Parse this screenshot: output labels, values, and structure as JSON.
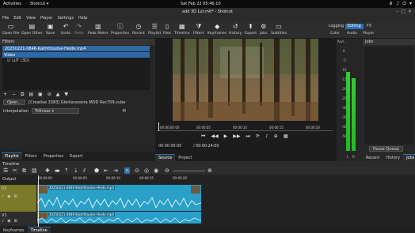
{
  "topbar": {
    "activities": "Activities",
    "app": "Shotcut ▾",
    "clock": "Sat Feb 22  05:46:10"
  },
  "window": {
    "title": "add 3D Lut.mlt* - Shotcut"
  },
  "menu": [
    "File",
    "Edit",
    "View",
    "Player",
    "Settings",
    "Help"
  ],
  "toolbar": {
    "buttons": [
      "Open File",
      "Open Other",
      "Save",
      "Undo",
      "Redo",
      "Peak Meter",
      "Properties",
      "Recent",
      "Playlist",
      "Files",
      "Timeline",
      "Filters",
      "Keyframes",
      "History",
      "Export",
      "Jobs",
      "Subtitles"
    ],
    "layouts": [
      "Logging",
      "Editing",
      "FX"
    ],
    "layout_sub": [
      "Color",
      "Audio",
      "Player"
    ]
  },
  "playlist": {
    "item": "20250221-0846-Kalmthoutse-Heide.mp4",
    "section": "Video",
    "track": "LUT (3D)"
  },
  "filters": {
    "label": "Filters",
    "open_button": "Open...",
    "lut_file": "[Creative 3383] Glenlaraneira MOD Rec709.cube",
    "interp_label": "Interpolation",
    "interp_value": "Trilinear"
  },
  "left_tabs": [
    "Playlist",
    "Filters",
    "Properties",
    "Export"
  ],
  "player": {
    "ticks": [
      "00:00:00:00",
      "00:00:05",
      "00:00:10",
      "00:00:15",
      "00:00:20"
    ],
    "position": "00:00:00:00",
    "duration": "/ 00:00:24:00",
    "tabs": [
      "Source",
      "Project"
    ]
  },
  "meter": {
    "label": "Aud...",
    "scale": [
      "0",
      "-5",
      "-10",
      "-15",
      "-20",
      "-25",
      "-30",
      "-35",
      "-40",
      "-50"
    ],
    "left": "L",
    "right": "R",
    "level_l": 0.78,
    "level_r": 0.72
  },
  "right_panel": {
    "label": "Jobs",
    "pause": "Pause Queue",
    "tabs": [
      "Recent",
      "History",
      "Jobs"
    ]
  },
  "timeline": {
    "label": "Timeline",
    "output": "Output",
    "ticks": [
      "00:00:00",
      "00:00:05",
      "00:00:10",
      "00:00:15",
      "00:00:20"
    ],
    "tracks": [
      {
        "name": "V2",
        "clip": "20250221-0846-Kalmthoutse-Heide.mp4"
      },
      {
        "name": "V1",
        "clip": "20250221-0846-Kalmthoutse-Heide.mp4"
      }
    ]
  },
  "bottom_tabs": [
    "Keyframes",
    "Timeline"
  ]
}
